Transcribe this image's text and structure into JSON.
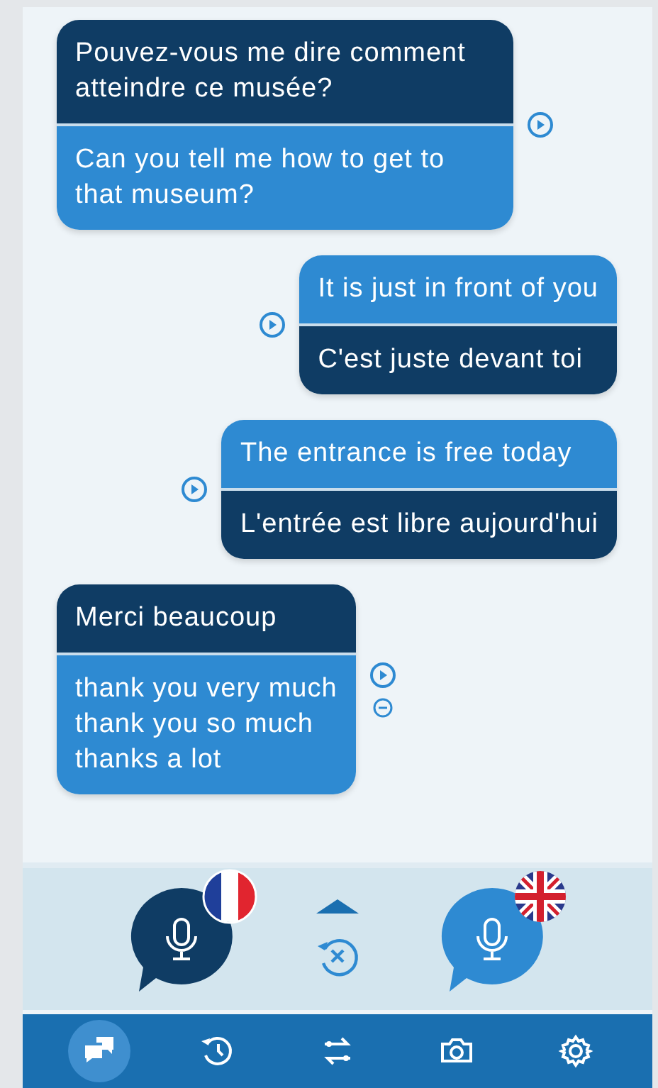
{
  "messages": [
    {
      "outgoing": false,
      "icons": [
        {
          "kind": "play"
        }
      ],
      "parts": [
        {
          "dark": true,
          "lines": [
            "Pouvez-vous me dire comment atteindre ce musée?"
          ]
        },
        {
          "dark": false,
          "lines": [
            "Can you tell me how to get to that museum?"
          ]
        }
      ]
    },
    {
      "outgoing": true,
      "icons": [
        {
          "kind": "play"
        }
      ],
      "parts": [
        {
          "dark": false,
          "lines": [
            "It is just in front of you"
          ]
        },
        {
          "dark": true,
          "lines": [
            "C'est juste devant toi"
          ]
        }
      ]
    },
    {
      "outgoing": true,
      "icons": [
        {
          "kind": "play"
        }
      ],
      "parts": [
        {
          "dark": false,
          "lines": [
            "The entrance is free today"
          ]
        },
        {
          "dark": true,
          "lines": [
            "L'entrée est libre aujourd'hui"
          ]
        }
      ]
    },
    {
      "outgoing": false,
      "icons": [
        {
          "kind": "play"
        },
        {
          "kind": "minus"
        }
      ],
      "parts": [
        {
          "dark": true,
          "lines": [
            "Merci beaucoup"
          ]
        },
        {
          "dark": false,
          "lines": [
            "thank you very much",
            "thank you so much",
            "thanks a lot"
          ]
        }
      ]
    }
  ],
  "mic_buttons": [
    {
      "dark": true,
      "kind": "fr"
    },
    {
      "dark": false,
      "kind": "gb"
    }
  ],
  "nav": [
    {
      "kind": "chat",
      "selected": true
    },
    {
      "kind": "history",
      "selected": false
    },
    {
      "kind": "swap",
      "selected": false
    },
    {
      "kind": "camera",
      "selected": false
    },
    {
      "kind": "settings",
      "selected": false
    }
  ]
}
